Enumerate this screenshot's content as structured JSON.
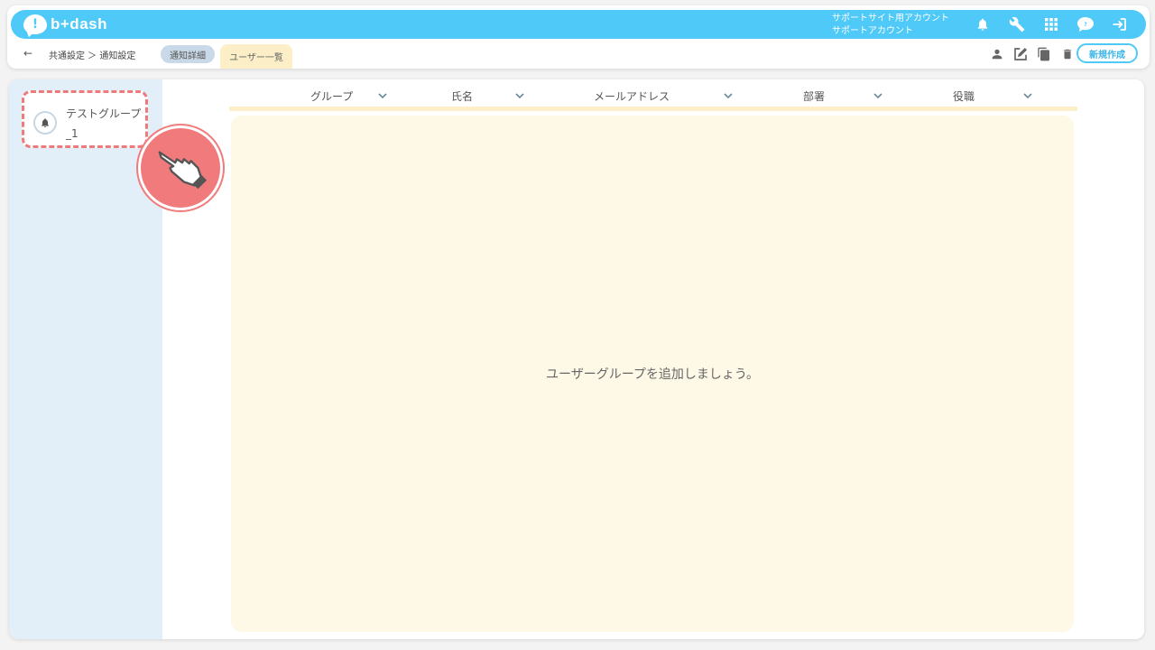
{
  "app": {
    "logo_text": "b+dash",
    "account_line1": "サポートサイト用アカウント",
    "account_line2": "サポートアカウント"
  },
  "header_icons": [
    "bell-icon",
    "wrench-icon",
    "grid-icon",
    "chat-bubble-icon",
    "logout-icon"
  ],
  "subnav": {
    "back_arrow": "←",
    "breadcrumb": "共通設定 ＞ 通知設定",
    "tab_detail": "通知詳細",
    "tab_users": "ユーザー一覧",
    "new_button": "新規作成"
  },
  "action_icons": [
    "person-icon",
    "edit-icon",
    "copy-icon",
    "trash-icon"
  ],
  "sidebar": {
    "group_item_label": "テストグループ_1"
  },
  "table": {
    "columns": [
      "グループ",
      "氏名",
      "メールアドレス",
      "部署",
      "役職"
    ]
  },
  "empty_message": "ユーザーグループを追加しましょう。",
  "colors": {
    "brand": "#4fc9f7",
    "highlight": "#f07a7c",
    "sidebar_bg": "#e2eef8",
    "panel_bg": "#fef8e6"
  }
}
